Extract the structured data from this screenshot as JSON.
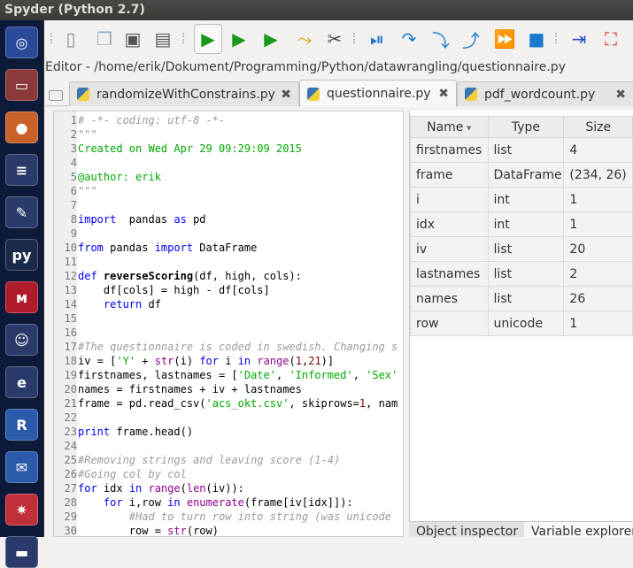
{
  "window": {
    "title": "Spyder (Python 2.7)"
  },
  "launcher": [
    {
      "name": "ubuntu-dash-icon",
      "glyph": "◎",
      "color": "#2c4a9a"
    },
    {
      "name": "files-icon",
      "glyph": "▭",
      "color": "#8a3a3a"
    },
    {
      "name": "firefox-icon",
      "glyph": "●",
      "color": "#c8612a"
    },
    {
      "name": "writer-icon",
      "glyph": "≡",
      "color": "#2a3a6a"
    },
    {
      "name": "settings-icon",
      "glyph": "✎",
      "color": "#2a3a6a"
    },
    {
      "name": "python-icon",
      "glyph": "py",
      "color": "#1a2a4a"
    },
    {
      "name": "mendeley-icon",
      "glyph": "ᴍ",
      "color": "#b01c2c"
    },
    {
      "name": "pidgin-icon",
      "glyph": "☺",
      "color": "#2a3a6a"
    },
    {
      "name": "pdf-viewer-icon",
      "glyph": "e",
      "color": "#2a3a6a"
    },
    {
      "name": "r-icon",
      "glyph": "R",
      "color": "#2a5aaa"
    },
    {
      "name": "thunderbird-icon",
      "glyph": "✉",
      "color": "#2a5aaa"
    },
    {
      "name": "spyder-icon",
      "glyph": "✷",
      "color": "#c0303a"
    },
    {
      "name": "disk-icon",
      "glyph": "▬",
      "color": "#2a3a6a"
    }
  ],
  "toolbar": [
    {
      "name": "new-file-icon",
      "glyph": "▯",
      "color": "#888"
    },
    {
      "name": "open-file-icon",
      "glyph": "❐",
      "color": "#9ab"
    },
    {
      "name": "save-icon",
      "glyph": "▣",
      "color": "#555"
    },
    {
      "name": "save-all-icon",
      "glyph": "▤",
      "color": "#555"
    },
    {
      "name": "run-icon",
      "glyph": "▶",
      "color": "#1a9a1a"
    },
    {
      "name": "run-cell-icon",
      "glyph": "▶",
      "color": "#1a9a1a"
    },
    {
      "name": "run-cell-advance-icon",
      "glyph": "▶",
      "color": "#1a9a1a"
    },
    {
      "name": "run-selection-icon",
      "glyph": "⤳",
      "color": "#d0a010"
    },
    {
      "name": "configure-run-icon",
      "glyph": "✂",
      "color": "#444"
    },
    {
      "name": "debug-icon",
      "glyph": "⏯",
      "color": "#1a7ad0"
    },
    {
      "name": "step-icon",
      "glyph": "↷",
      "color": "#1a7ad0"
    },
    {
      "name": "step-into-icon",
      "glyph": "⤵",
      "color": "#1a7ad0"
    },
    {
      "name": "step-return-icon",
      "glyph": "⤴",
      "color": "#1a7ad0"
    },
    {
      "name": "continue-icon",
      "glyph": "⏩",
      "color": "#1a7ad0"
    },
    {
      "name": "stop-debug-icon",
      "glyph": "■",
      "color": "#1a7ad0"
    },
    {
      "name": "maximize-pane-icon",
      "glyph": "⇥",
      "color": "#2a4ad0"
    },
    {
      "name": "fullscreen-icon",
      "glyph": "⛶",
      "color": "#d02020"
    }
  ],
  "editor": {
    "label": "Editor - /home/erik/Dokument/Programming/Python/datawrangling/questionnaire.py",
    "tabs": [
      {
        "label": "randomizeWithConstrains.py",
        "active": false
      },
      {
        "label": "questionnaire.py",
        "active": true
      },
      {
        "label": "pdf_wordcount.py",
        "active": false
      }
    ],
    "close_glyph": "✖",
    "lines": [
      [
        [
          "c",
          "# -*- coding: utf-8 -*-"
        ]
      ],
      [
        [
          "c",
          "\"\"\""
        ]
      ],
      [
        [
          "s",
          "Created on Wed Apr 29 09:29:09 2015"
        ]
      ],
      [],
      [
        [
          "s",
          "@author: erik"
        ]
      ],
      [
        [
          "c",
          "\"\"\""
        ]
      ],
      [],
      [
        [
          "k",
          "import"
        ],
        [
          "",
          "  pandas "
        ],
        [
          "k",
          "as"
        ],
        [
          "",
          " pd"
        ]
      ],
      [],
      [
        [
          "k",
          "from"
        ],
        [
          "",
          " pandas "
        ],
        [
          "k",
          "import"
        ],
        [
          "",
          " DataFrame"
        ]
      ],
      [],
      [
        [
          "k",
          "def"
        ],
        [
          " ",
          ""
        ],
        [
          "f",
          "reverseScoring"
        ],
        [
          "",
          "(df, high, cols):"
        ]
      ],
      [
        [
          "",
          "    df[cols] = high - df[cols]"
        ]
      ],
      [
        [
          "k",
          "    return"
        ],
        [
          "",
          " df"
        ]
      ],
      [],
      [],
      [
        [
          "c",
          "#The questionnaire is coded in swedish. Changing s"
        ]
      ],
      [
        [
          "",
          "iv = ["
        ],
        [
          "s",
          "'Y'"
        ],
        [
          "",
          " + "
        ],
        [
          "b",
          "str"
        ],
        [
          "",
          "(i) "
        ],
        [
          "k",
          "for"
        ],
        [
          "",
          " i "
        ],
        [
          "k",
          "in"
        ],
        [
          " ",
          ""
        ],
        [
          "b",
          "range"
        ],
        [
          "",
          "("
        ],
        [
          "n",
          "1"
        ],
        [
          "",
          ","
        ],
        [
          "n",
          "21"
        ],
        [
          "",
          ")]"
        ]
      ],
      [
        [
          "",
          "firstnames, lastnames = ["
        ],
        [
          "s",
          "'Date'"
        ],
        [
          "",
          ", "
        ],
        [
          "s",
          "'Informed'"
        ],
        [
          "",
          ", "
        ],
        [
          "s",
          "'Sex'"
        ]
      ],
      [
        [
          "",
          "names = firstnames + iv + lastnames"
        ]
      ],
      [
        [
          "",
          "frame = pd.read_csv("
        ],
        [
          "s",
          "'acs_okt.csv'"
        ],
        [
          "",
          ", skiprows="
        ],
        [
          "n",
          "1"
        ],
        [
          "",
          ", nam"
        ]
      ],
      [],
      [
        [
          "k",
          "print"
        ],
        [
          "",
          " frame.head()"
        ]
      ],
      [],
      [
        [
          "c",
          "#Removing strings and leaving score (1-4)"
        ]
      ],
      [
        [
          "c",
          "#Going col by col"
        ]
      ],
      [
        [
          "k",
          "for"
        ],
        [
          "",
          " idx "
        ],
        [
          "k",
          "in"
        ],
        [
          " ",
          ""
        ],
        [
          "b",
          "range"
        ],
        [
          "",
          "("
        ],
        [
          "b",
          "len"
        ],
        [
          "",
          "(iv)):"
        ]
      ],
      [
        [
          "k",
          "    for"
        ],
        [
          "",
          " i,row "
        ],
        [
          "k",
          "in"
        ],
        [
          " ",
          ""
        ],
        [
          "b",
          "enumerate"
        ],
        [
          "",
          "(frame[iv[idx]]):"
        ]
      ],
      [
        [
          "c",
          "        #Had to turn row into string (was unicode"
        ]
      ],
      [
        [
          "",
          "        row = "
        ],
        [
          "b",
          "str"
        ],
        [
          "",
          "(row)"
        ]
      ]
    ]
  },
  "variable_explorer": {
    "columns": [
      "Name",
      "Type",
      "Size"
    ],
    "sort_glyph": "▾",
    "rows": [
      [
        "firstnames",
        "list",
        "4"
      ],
      [
        "frame",
        "DataFrame",
        "(234, 26)"
      ],
      [
        "i",
        "int",
        "1"
      ],
      [
        "idx",
        "int",
        "1"
      ],
      [
        "iv",
        "list",
        "20"
      ],
      [
        "lastnames",
        "list",
        "2"
      ],
      [
        "names",
        "list",
        "26"
      ],
      [
        "row",
        "unicode",
        "1"
      ]
    ]
  },
  "bottom_tabs": [
    {
      "label": "Object inspector",
      "active": false
    },
    {
      "label": "Variable explorer",
      "active": true
    }
  ]
}
